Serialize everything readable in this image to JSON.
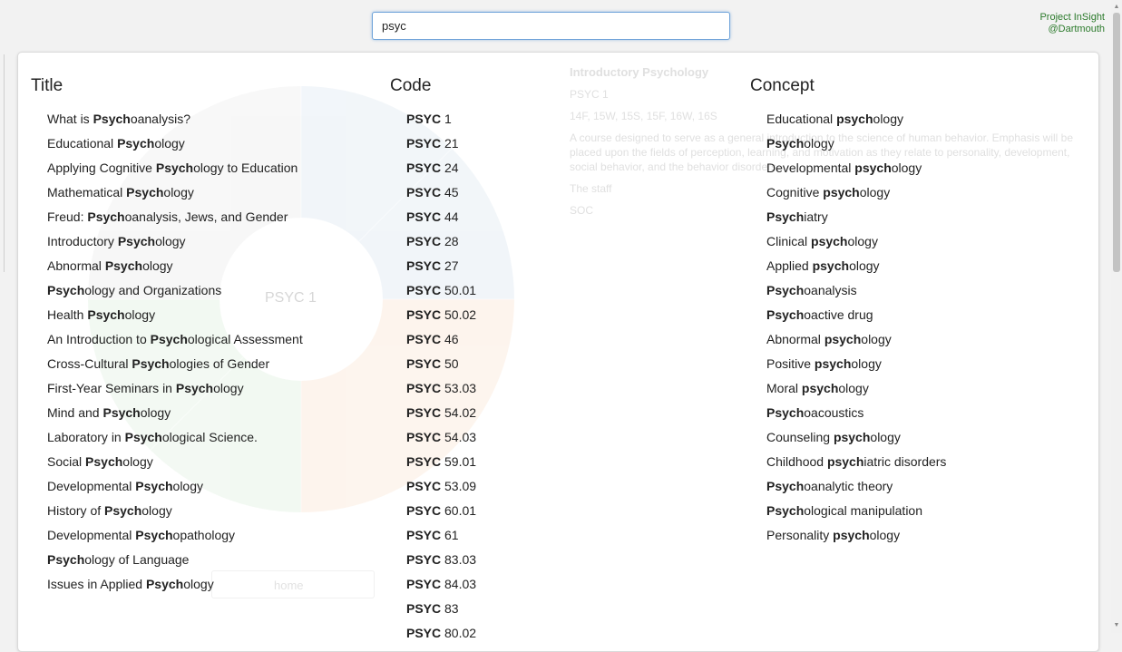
{
  "search": {
    "value": "psyc"
  },
  "brand": {
    "line1": "Project InSight",
    "line2": "@Dartmouth"
  },
  "background": {
    "center_label": "PSYC 1",
    "home_button": "home",
    "detail": {
      "title": "Introductory Psychology",
      "code": "PSYC 1",
      "terms": "14F, 15W, 15S, 15F, 16W, 16S",
      "description": "A course designed to serve as a general introduction to the science of human behavior. Emphasis will be placed upon the fields of perception, learning, and motivation as they relate to personality, development, social behavior, and the behavior disorders.",
      "instructor": "The staff",
      "distrib": "SOC"
    }
  },
  "title_column": {
    "heading": "Title",
    "items": [
      {
        "pre": "What is ",
        "match": "Psych",
        "post": "oanalysis?"
      },
      {
        "pre": "Educational ",
        "match": "Psych",
        "post": "ology"
      },
      {
        "pre": "Applying Cognitive ",
        "match": "Psych",
        "post": "ology to Education"
      },
      {
        "pre": "Mathematical ",
        "match": "Psych",
        "post": "ology"
      },
      {
        "pre": "Freud: ",
        "match": "Psych",
        "post": "oanalysis, Jews, and Gender"
      },
      {
        "pre": "Introductory ",
        "match": "Psych",
        "post": "ology"
      },
      {
        "pre": "Abnormal ",
        "match": "Psych",
        "post": "ology"
      },
      {
        "pre": "",
        "match": "Psych",
        "post": "ology and Organizations"
      },
      {
        "pre": "Health ",
        "match": "Psych",
        "post": "ology"
      },
      {
        "pre": "An Introduction to ",
        "match": "Psych",
        "post": "ological Assessment"
      },
      {
        "pre": "Cross-Cultural ",
        "match": "Psych",
        "post": "ologies of Gender"
      },
      {
        "pre": "First-Year Seminars in ",
        "match": "Psych",
        "post": "ology"
      },
      {
        "pre": "Mind and ",
        "match": "Psych",
        "post": "ology"
      },
      {
        "pre": "Laboratory in ",
        "match": "Psych",
        "post": "ological Science."
      },
      {
        "pre": "Social ",
        "match": "Psych",
        "post": "ology"
      },
      {
        "pre": "Developmental ",
        "match": "Psych",
        "post": "ology"
      },
      {
        "pre": "History of ",
        "match": "Psych",
        "post": "ology"
      },
      {
        "pre": "Developmental ",
        "match": "Psych",
        "post": "opathology"
      },
      {
        "pre": "",
        "match": "Psych",
        "post": "ology of Language"
      },
      {
        "pre": "Issues in Applied ",
        "match": "Psych",
        "post": "ology"
      }
    ]
  },
  "code_column": {
    "heading": "Code",
    "items": [
      {
        "pre": "",
        "match": "PSYC",
        "post": " 1"
      },
      {
        "pre": "",
        "match": "PSYC",
        "post": " 21"
      },
      {
        "pre": "",
        "match": "PSYC",
        "post": " 24"
      },
      {
        "pre": "",
        "match": "PSYC",
        "post": " 45"
      },
      {
        "pre": "",
        "match": "PSYC",
        "post": " 44"
      },
      {
        "pre": "",
        "match": "PSYC",
        "post": " 28"
      },
      {
        "pre": "",
        "match": "PSYC",
        "post": " 27"
      },
      {
        "pre": "",
        "match": "PSYC",
        "post": " 50.01"
      },
      {
        "pre": "",
        "match": "PSYC",
        "post": " 50.02"
      },
      {
        "pre": "",
        "match": "PSYC",
        "post": " 46"
      },
      {
        "pre": "",
        "match": "PSYC",
        "post": " 50"
      },
      {
        "pre": "",
        "match": "PSYC",
        "post": " 53.03"
      },
      {
        "pre": "",
        "match": "PSYC",
        "post": " 54.02"
      },
      {
        "pre": "",
        "match": "PSYC",
        "post": " 54.03"
      },
      {
        "pre": "",
        "match": "PSYC",
        "post": " 59.01"
      },
      {
        "pre": "",
        "match": "PSYC",
        "post": " 53.09"
      },
      {
        "pre": "",
        "match": "PSYC",
        "post": " 60.01"
      },
      {
        "pre": "",
        "match": "PSYC",
        "post": " 61"
      },
      {
        "pre": "",
        "match": "PSYC",
        "post": " 83.03"
      },
      {
        "pre": "",
        "match": "PSYC",
        "post": " 84.03"
      },
      {
        "pre": "",
        "match": "PSYC",
        "post": " 83"
      },
      {
        "pre": "",
        "match": "PSYC",
        "post": " 80.02"
      }
    ]
  },
  "concept_column": {
    "heading": "Concept",
    "items": [
      {
        "pre": "Educational ",
        "match": "psych",
        "post": "ology"
      },
      {
        "pre": "",
        "match": "Psych",
        "post": "ology"
      },
      {
        "pre": "Developmental ",
        "match": "psych",
        "post": "ology"
      },
      {
        "pre": "Cognitive ",
        "match": "psych",
        "post": "ology"
      },
      {
        "pre": "",
        "match": "Psych",
        "post": "iatry"
      },
      {
        "pre": "Clinical ",
        "match": "psych",
        "post": "ology"
      },
      {
        "pre": "Applied ",
        "match": "psych",
        "post": "ology"
      },
      {
        "pre": "",
        "match": "Psych",
        "post": "oanalysis"
      },
      {
        "pre": "",
        "match": "Psych",
        "post": "oactive drug"
      },
      {
        "pre": "Abnormal ",
        "match": "psych",
        "post": "ology"
      },
      {
        "pre": "Positive ",
        "match": "psych",
        "post": "ology"
      },
      {
        "pre": "Moral ",
        "match": "psych",
        "post": "ology"
      },
      {
        "pre": "",
        "match": "Psych",
        "post": "oacoustics"
      },
      {
        "pre": "Counseling ",
        "match": "psych",
        "post": "ology"
      },
      {
        "pre": "Childhood ",
        "match": "psych",
        "post": "iatric disorders"
      },
      {
        "pre": "",
        "match": "Psych",
        "post": "oanalytic theory"
      },
      {
        "pre": "",
        "match": "Psych",
        "post": "ological manipulation"
      },
      {
        "pre": "Personality ",
        "match": "psych",
        "post": "ology"
      }
    ]
  }
}
